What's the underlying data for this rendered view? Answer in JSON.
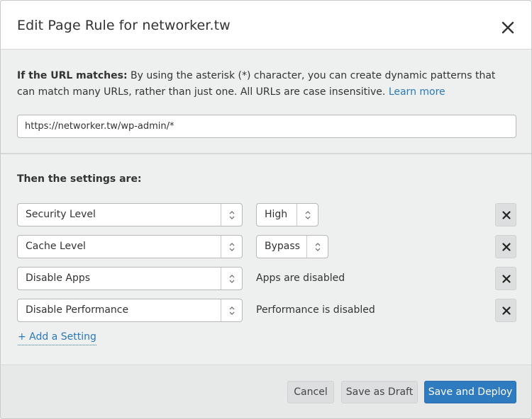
{
  "dialog": {
    "title": "Edit Page Rule for networker.tw"
  },
  "url_section": {
    "lead": "If the URL matches:",
    "description": " By using the asterisk (*) character, you can create dynamic patterns that can match many URLs, rather than just one. All URLs are case insensitive. ",
    "learn_more": "Learn more",
    "url_value": "https://networker.tw/wp-admin/*"
  },
  "settings": {
    "title": "Then the settings are:",
    "rows": [
      {
        "setting": "Security Level",
        "value": "High",
        "value_type": "select"
      },
      {
        "setting": "Cache Level",
        "value": "Bypass",
        "value_type": "select"
      },
      {
        "setting": "Disable Apps",
        "value": "Apps are disabled",
        "value_type": "text"
      },
      {
        "setting": "Disable Performance",
        "value": "Performance is disabled",
        "value_type": "text"
      }
    ],
    "add_label": "+ Add a Setting"
  },
  "footer": {
    "cancel_label": "Cancel",
    "draft_label": "Save as Draft",
    "deploy_label": "Save and Deploy"
  },
  "colors": {
    "link": "#2b79b5",
    "primary_button": "#2f7bbf"
  },
  "icons": {
    "close": "close-icon",
    "stepper": "chevron-up-down-icon",
    "remove": "remove-x-icon"
  }
}
